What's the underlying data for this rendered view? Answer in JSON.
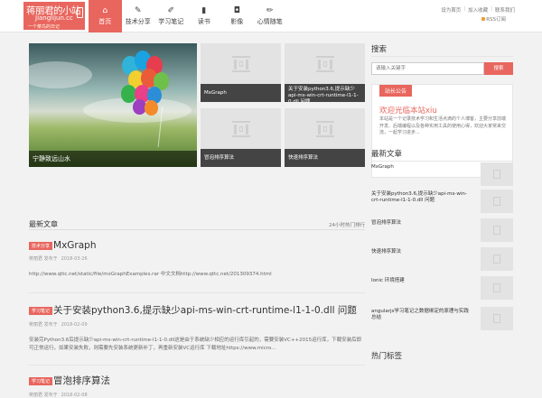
{
  "header": {
    "logo_title": "蒋丽君的小站",
    "logo_domain": "Jianglijun.cc",
    "logo_slogan": "一个菜鸟的日记",
    "nav": [
      {
        "label": "首页",
        "icon": "home-icon",
        "glyph": "⌂"
      },
      {
        "label": "技术分享",
        "icon": "edit-icon",
        "glyph": "✎"
      },
      {
        "label": "学习笔记",
        "icon": "note-icon",
        "glyph": "✐"
      },
      {
        "label": "读书",
        "icon": "bookmark-icon",
        "glyph": "▮"
      },
      {
        "label": "影像",
        "icon": "camera-icon",
        "glyph": "◘"
      },
      {
        "label": "心情随笔",
        "icon": "pen-icon",
        "glyph": "✏"
      }
    ],
    "toplinks": [
      "设为首页",
      "加入收藏",
      "联系我们"
    ],
    "rss_label": "RSS订阅"
  },
  "featured": {
    "hero_caption": "宁静致远山水",
    "thumbs": [
      {
        "caption": "MxGraph"
      },
      {
        "caption": "关于安装python3.6,提示缺少api-ms-win-crt-runtime-l1-1-0.dll 问题"
      },
      {
        "caption": "冒泡排序算法"
      },
      {
        "caption": "快速排序算法"
      }
    ]
  },
  "list_header": {
    "title": "最新文章",
    "rank": "24小时热门排行"
  },
  "posts": [
    {
      "tag": "技术分享",
      "title": "MxGraph",
      "author": "蒋丽君 发布于",
      "date": "2018-03-26",
      "excerpt": "http://www.qttc.net/static/file/mxGraphExamples.rar 中文文档http://www.qttc.net/201309374.html"
    },
    {
      "tag": "学习笔记",
      "title": "关于安装python3.6,提示缺少api-ms-win-crt-runtime-l1-1-0.dll 问题",
      "author": "蒋丽君 发布于",
      "date": "2018-02-09",
      "excerpt": "安装完Python3.6后提示缺少api-ms-win-crt-runtime-l1-1-0.dll这是由于系统缺少相应的运行库引起的，需要安装VC++2015运行库，下载安装后即可正常运行，如果安装失败，则需要先安装系统更新补丁，再重新安装VC运行库 下载地址https://www.micro..."
    },
    {
      "tag": "学习笔记",
      "title": "冒泡排序算法",
      "author": "蒋丽君 发布于",
      "date": "2018-02-08",
      "excerpt": ""
    }
  ],
  "sidebar": {
    "search_title": "搜索",
    "search_placeholder": "请输入关键字",
    "search_button": "搜索",
    "bulletin_tag": "站长公告",
    "bulletin_name": "欢迎光临本站xiu",
    "bulletin_desc": "本站是一个记录技术学习和生活点滴的个人博客，主要分享前端开发、后端编程以及各种实用工具的使用心得，欢迎大家常来交流，一起学习进步...",
    "latest_title": "最新文章",
    "latest": [
      {
        "title": "MxGraph"
      },
      {
        "title": "关于安装python3.6,提示缺少api-ms-win-crt-runtime-l1-1-0.dll 问题"
      },
      {
        "title": "冒泡排序算法"
      },
      {
        "title": "快速排序算法"
      },
      {
        "title": "Ionic 环境搭建"
      },
      {
        "title": "angularjs学习笔记之数据绑定的原理与实践总结"
      }
    ],
    "bottom_title": "热门标签"
  },
  "colors": {
    "accent": "#e8665e"
  }
}
